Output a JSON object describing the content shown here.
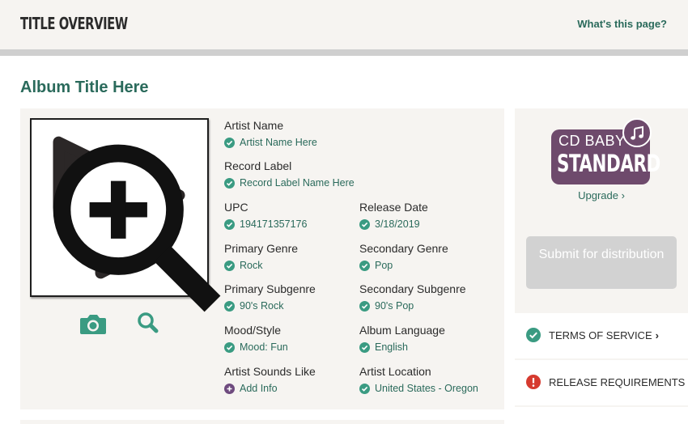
{
  "header": {
    "title": "TITLE OVERVIEW",
    "help_link": "What's this page?"
  },
  "album": {
    "title": "Album Title Here"
  },
  "fields": {
    "artist_name": {
      "label": "Artist Name",
      "value": "Artist Name Here"
    },
    "record_label": {
      "label": "Record Label",
      "value": "Record Label Name Here"
    },
    "upc": {
      "label": "UPC",
      "value": "194171357176"
    },
    "release_date": {
      "label": "Release Date",
      "value": "3/18/2019"
    },
    "primary_genre": {
      "label": "Primary Genre",
      "value": "Rock"
    },
    "secondary_genre": {
      "label": "Secondary Genre",
      "value": "Pop"
    },
    "primary_subgenre": {
      "label": "Primary Subgenre",
      "value": "90's Rock"
    },
    "secondary_subgenre": {
      "label": "Secondary Subgenre",
      "value": "90's Pop"
    },
    "mood_style": {
      "label": "Mood/Style",
      "value": "Mood: Fun"
    },
    "album_language": {
      "label": "Album Language",
      "value": "English"
    },
    "artist_sounds_like": {
      "label": "Artist Sounds Like",
      "value": "Add Info"
    },
    "artist_location": {
      "label": "Artist Location",
      "value": "United States - Oregon"
    }
  },
  "sidebar": {
    "plan_line1": "CD BABY",
    "plan_line2": "STANDARD",
    "upgrade_label": "Upgrade ›",
    "submit_label": "Submit for distribution",
    "links": [
      {
        "label": "TERMS OF SERVICE",
        "status": "complete",
        "icon": "check-circle-icon"
      },
      {
        "label": "RELEASE REQUIREMENTS",
        "status": "error",
        "icon": "alert-circle-icon"
      }
    ]
  },
  "icons": {
    "art_tools": [
      "camera-icon",
      "magnifier-icon"
    ],
    "status_check": "check-circle-icon",
    "status_add": "plus-circle-icon"
  },
  "colors": {
    "accent": "#2a6a5b",
    "check": "#3a9b82",
    "plan_badge": "#6e4a6c",
    "error": "#d63a2f",
    "panel_bg": "#f6f4f1"
  }
}
